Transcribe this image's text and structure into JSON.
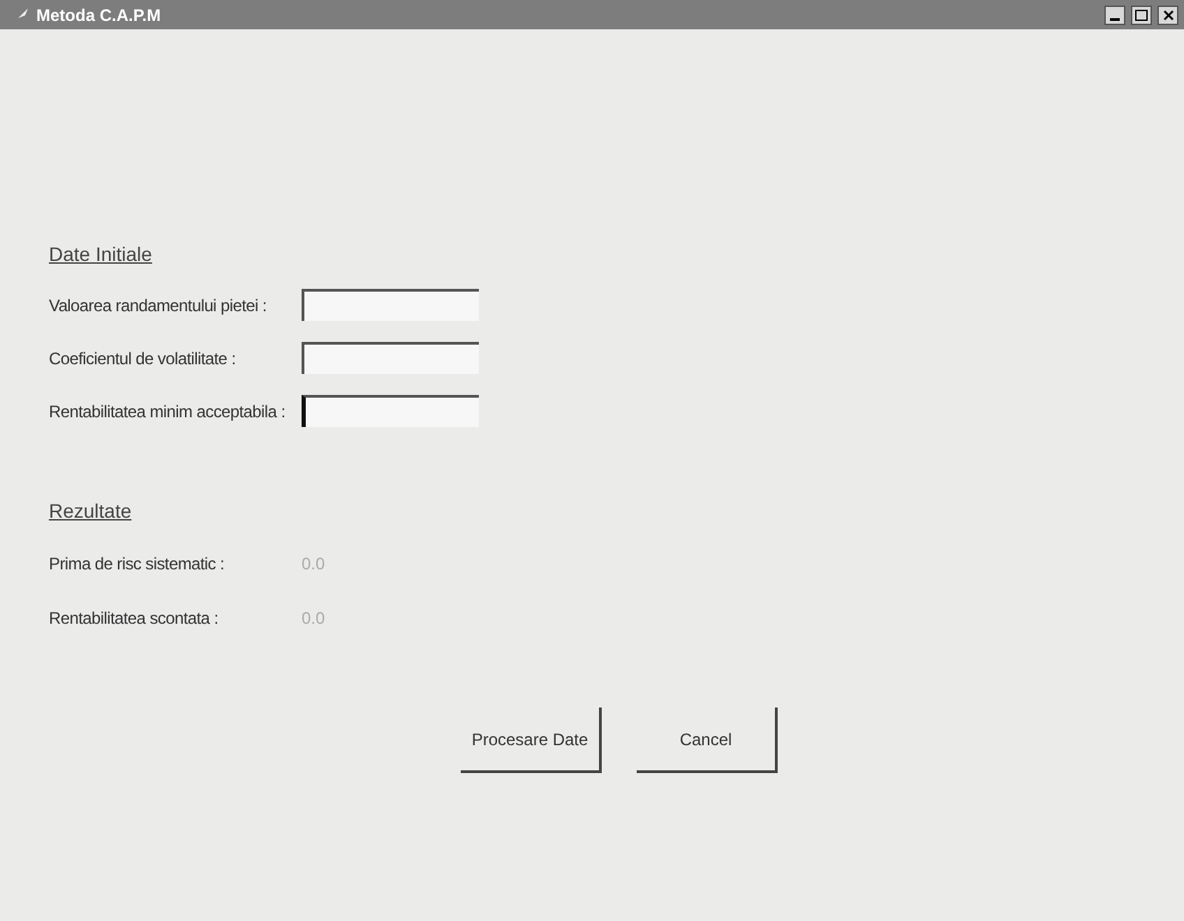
{
  "window": {
    "title": "Metoda C.A.P.M"
  },
  "inputs_section": {
    "heading": "Date Initiale",
    "fields": [
      {
        "label": "Valoarea randamentului pietei :",
        "focused": false
      },
      {
        "label": "Coeficientul de volatilitate :",
        "focused": false
      },
      {
        "label": "Rentabilitatea minim acceptabila :",
        "focused": true
      }
    ]
  },
  "results_section": {
    "heading": "Rezultate",
    "rows": [
      {
        "label": "Prima de risc sistematic :",
        "value": "0.0"
      },
      {
        "label": "Rentabilitatea scontata :",
        "value": "0.0"
      }
    ]
  },
  "buttons": [
    "Procesare Date",
    "Cancel"
  ]
}
